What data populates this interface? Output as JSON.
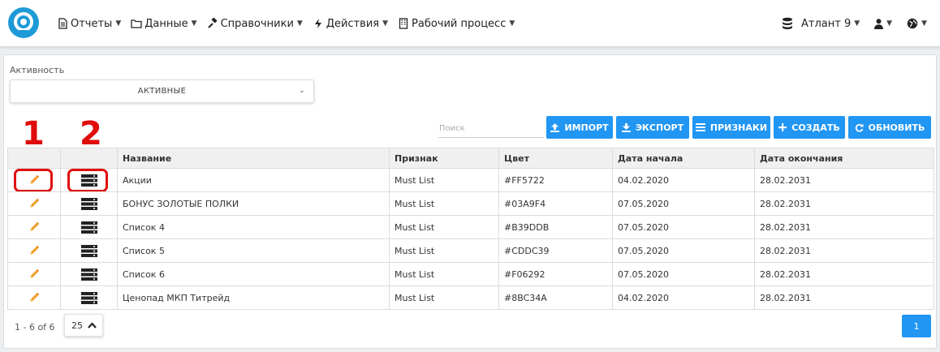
{
  "nav": {
    "items": [
      {
        "label": "Отчеты",
        "icon": "file-icon"
      },
      {
        "label": "Данные",
        "icon": "folder-icon"
      },
      {
        "label": "Справочники",
        "icon": "gavel-icon"
      },
      {
        "label": "Действия",
        "icon": "bolt-icon"
      },
      {
        "label": "Рабочий процесс",
        "icon": "building-icon"
      }
    ],
    "database_label": "Атлант 9"
  },
  "filter": {
    "label": "Активность",
    "value": "АКТИВНЫЕ"
  },
  "search": {
    "placeholder": "Поиск"
  },
  "toolbar": {
    "import_label": "ИМПОРТ",
    "export_label": "ЭКСПОРТ",
    "features_label": "ПРИЗНАКИ",
    "create_label": "СОЗДАТЬ",
    "refresh_label": "ОБНОВИТЬ"
  },
  "markers": [
    "1",
    "2"
  ],
  "table": {
    "columns": [
      "",
      "",
      "Название",
      "Признак",
      "Цвет",
      "Дата начала",
      "Дата окончания"
    ],
    "rows": [
      {
        "name": "Акции",
        "feature": "Must List",
        "color": "#FF5722",
        "start": "04.02.2020",
        "end": "28.02.2031"
      },
      {
        "name": "БОНУС ЗОЛОТЫЕ ПОЛКИ",
        "feature": "Must List",
        "color": "#03A9F4",
        "start": "07.05.2020",
        "end": "28.02.2031"
      },
      {
        "name": "Список 4",
        "feature": "Must List",
        "color": "#B39DDB",
        "start": "07.05.2020",
        "end": "28.02.2031"
      },
      {
        "name": "Список 5",
        "feature": "Must List",
        "color": "#CDDC39",
        "start": "07.05.2020",
        "end": "28.02.2031"
      },
      {
        "name": "Список 6",
        "feature": "Must List",
        "color": "#F06292",
        "start": "07.05.2020",
        "end": "28.02.2031"
      },
      {
        "name": "Ценопад МКП Титрейд",
        "feature": "Must List",
        "color": "#8BC34A",
        "start": "04.02.2020",
        "end": "28.02.2031"
      }
    ]
  },
  "pagination": {
    "range": "1 - 6 of 6",
    "page_size": "25",
    "current_page": "1"
  },
  "colors": {
    "accent": "#2196F3",
    "edit_icon": "#F0A030",
    "marker": "#E00B0B",
    "logo": "#1E9BD7"
  }
}
